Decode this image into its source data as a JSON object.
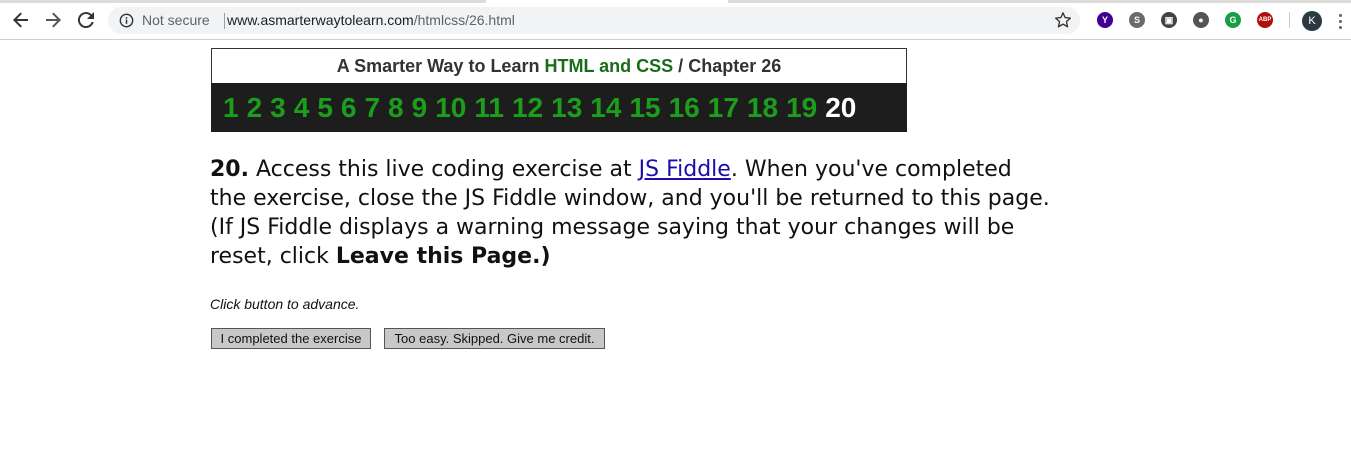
{
  "browser": {
    "security_status": "Not secure",
    "url_domain": "www.asmarterwaytolearn.com",
    "url_path": "/htmlcss/26.html",
    "profile_initial": "K",
    "extensions": [
      {
        "name": "yahoo-extension-icon",
        "color": "#410093",
        "glyph": "Y"
      },
      {
        "name": "skype-extension-icon",
        "color": "#6b6b6b",
        "glyph": "S"
      },
      {
        "name": "image-extension-icon",
        "color": "#444444",
        "glyph": "▣"
      },
      {
        "name": "circle-extension-icon",
        "color": "#555555",
        "glyph": "●"
      },
      {
        "name": "grammarly-extension-icon",
        "color": "#15a048",
        "glyph": "G"
      },
      {
        "name": "adblock-extension-icon",
        "color": "#b10e0e",
        "glyph": "ABP"
      }
    ]
  },
  "header": {
    "title_prefix": "A Smarter Way to Learn",
    "title_highlight": "HTML and CSS",
    "title_separator": "/",
    "title_chapter": "Chapter 26",
    "chapters": [
      "1",
      "2",
      "3",
      "4",
      "5",
      "6",
      "7",
      "8",
      "9",
      "10",
      "11",
      "12",
      "13",
      "14",
      "15",
      "16",
      "17",
      "18",
      "19",
      "20"
    ],
    "current_chapter": "20"
  },
  "exercise": {
    "number": "20.",
    "text_before_link": " Access this live coding exercise at ",
    "link_text": "JS Fiddle",
    "text_after_link": ". When you've completed the exercise, close the JS Fiddle window, and you'll be returned to this page. (If JS Fiddle displays a warning message saying that your changes will be reset, click ",
    "bold_end": "Leave this Page.)"
  },
  "instruction": "Click button to advance.",
  "buttons": {
    "completed": "I completed the exercise",
    "skipped": "Too easy. Skipped. Give me credit."
  }
}
